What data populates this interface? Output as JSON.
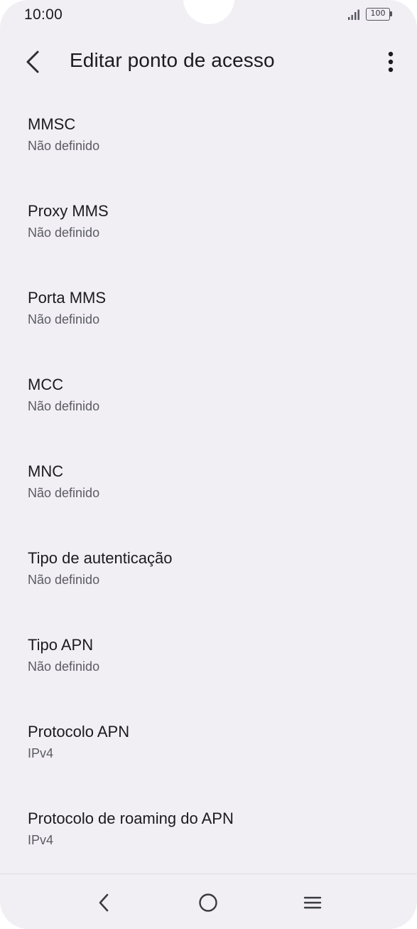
{
  "status_bar": {
    "time": "10:00",
    "battery": "100",
    "icons": [
      "signal-icon",
      "battery-icon"
    ]
  },
  "app_bar": {
    "title": "Editar ponto de acesso",
    "icons": [
      "back-arrow-icon",
      "more-vert-icon"
    ]
  },
  "settings": [
    {
      "title": "MMSC",
      "value": "Não definido"
    },
    {
      "title": "Proxy MMS",
      "value": "Não definido"
    },
    {
      "title": "Porta MMS",
      "value": "Não definido"
    },
    {
      "title": "MCC",
      "value": "Não definido"
    },
    {
      "title": "MNC",
      "value": "Não definido"
    },
    {
      "title": "Tipo de autenticação",
      "value": "Não definido"
    },
    {
      "title": "Tipo APN",
      "value": "Não definido"
    },
    {
      "title": "Protocolo APN",
      "value": "IPv4"
    },
    {
      "title": "Protocolo de roaming do APN",
      "value": "IPv4"
    }
  ],
  "nav_bar": {
    "icons": [
      "nav-back-icon",
      "nav-home-icon",
      "nav-recents-icon"
    ]
  },
  "colors": {
    "background": "#f1eff3",
    "primary_text": "#1b1b1f",
    "secondary_text": "#5b5b63"
  }
}
